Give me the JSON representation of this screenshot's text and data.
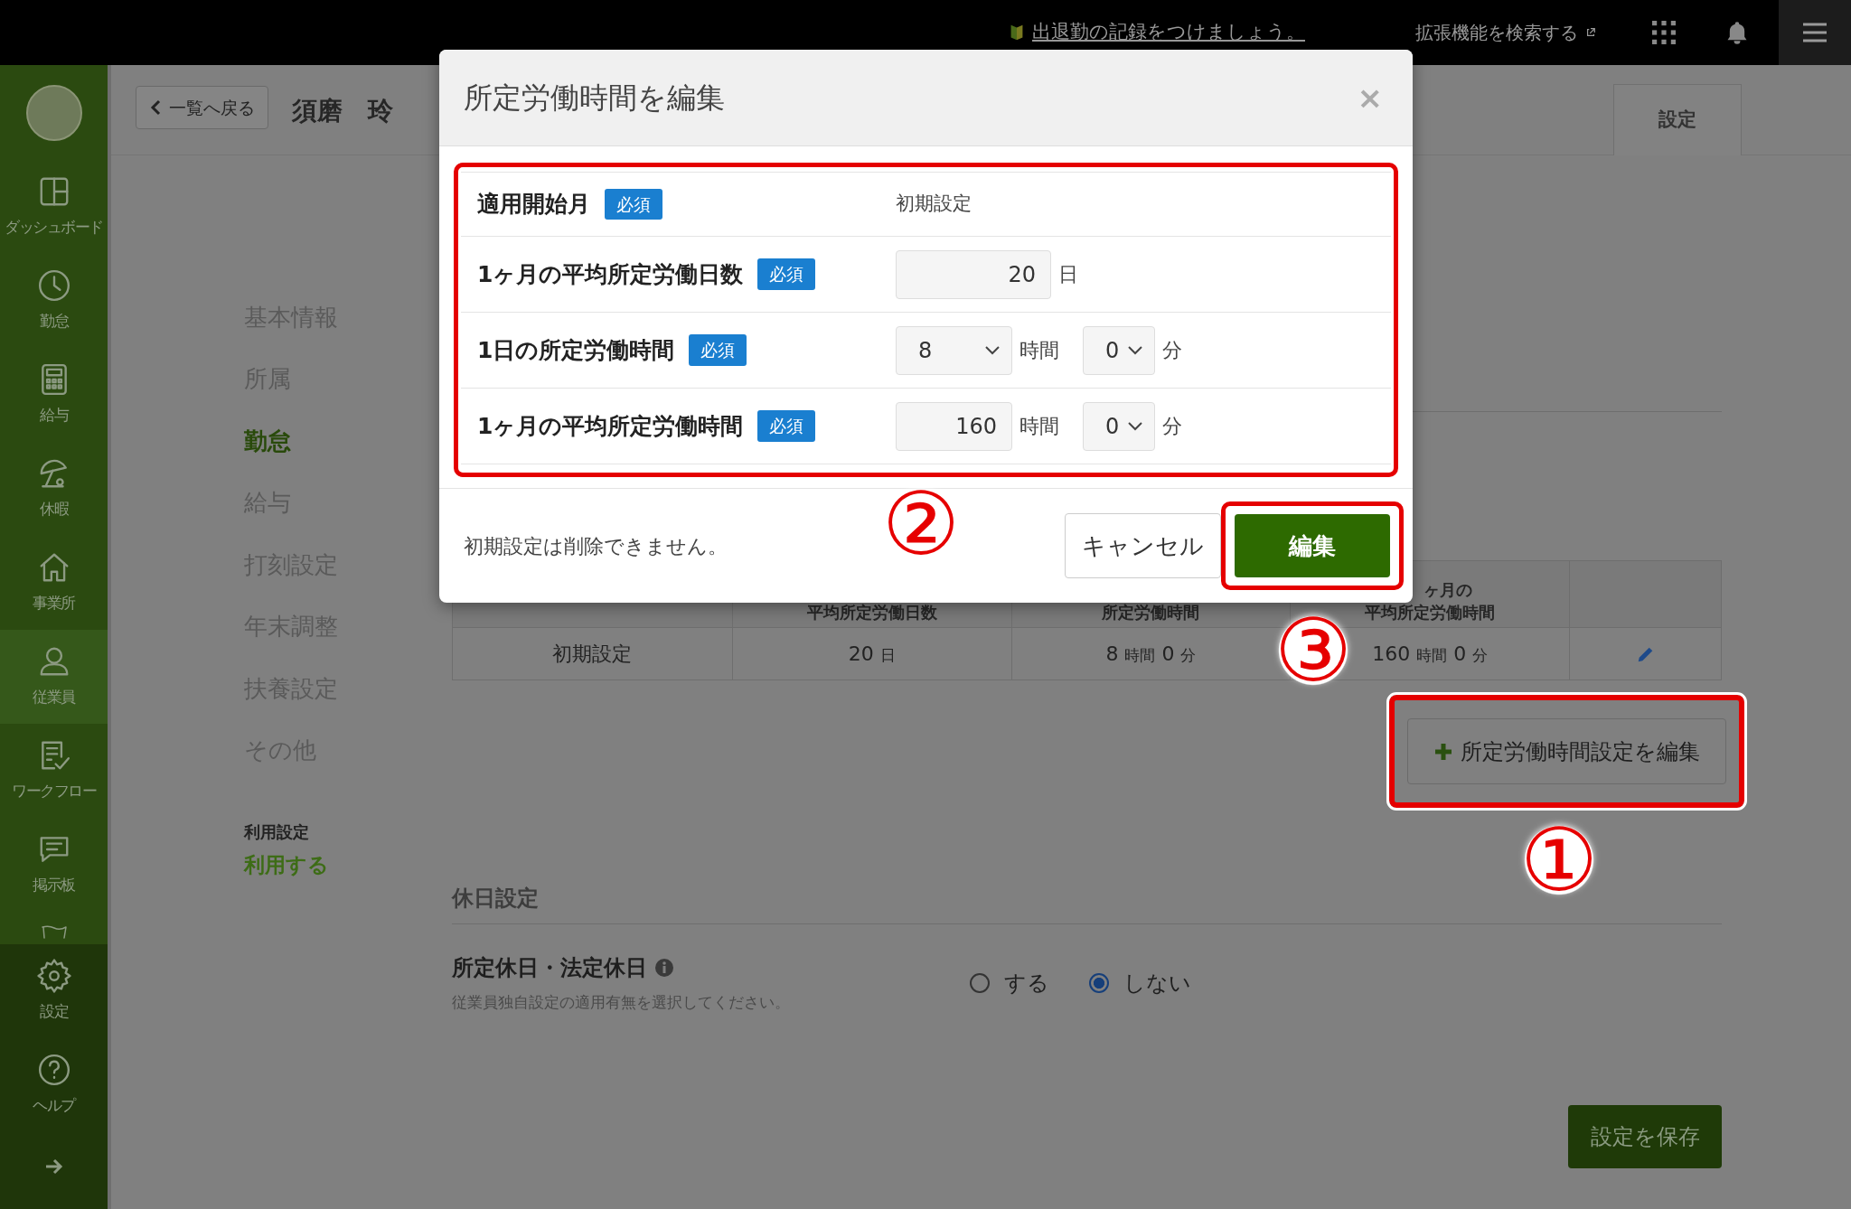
{
  "top_bar": {
    "notice": "出退勤の記録をつけましょう。",
    "extension_link": "拡張機能を検索する"
  },
  "sidebar": {
    "items": [
      {
        "label": "ダッシュボード",
        "selected": false
      },
      {
        "label": "勤怠",
        "selected": false
      },
      {
        "label": "給与",
        "selected": false
      },
      {
        "label": "休暇",
        "selected": false
      },
      {
        "label": "事業所",
        "selected": false
      },
      {
        "label": "従業員",
        "selected": true
      },
      {
        "label": "ワークフロー",
        "selected": false
      },
      {
        "label": "掲示板",
        "selected": false
      }
    ],
    "bottom_items": [
      {
        "label": "設定"
      },
      {
        "label": "ヘルプ"
      }
    ]
  },
  "header": {
    "back_button": "一覧へ戻る",
    "employee_name": "須磨　玲",
    "settings_button": "設定"
  },
  "nav": {
    "items": [
      {
        "label": "基本情報",
        "selected": false
      },
      {
        "label": "所属",
        "selected": false
      },
      {
        "label": "勤怠",
        "selected": true
      },
      {
        "label": "給与",
        "selected": false
      },
      {
        "label": "打刻設定",
        "selected": false
      },
      {
        "label": "年末調整",
        "selected": false
      },
      {
        "label": "扶養設定",
        "selected": false
      },
      {
        "label": "その他",
        "selected": false
      }
    ],
    "usage_label": "利用設定",
    "usage_value": "利用する"
  },
  "table": {
    "columns": [
      {},
      {
        "heading": [
          "平均所定労働日数"
        ]
      },
      {
        "heading": [
          "所定労働時間"
        ]
      },
      {
        "heading": [
          "ヶ月の",
          "平均所定労働時間"
        ]
      },
      {}
    ],
    "rows": [
      {
        "cells": [
          [
            "初期設定"
          ],
          [
            "20",
            "日"
          ],
          [
            "8",
            "時間",
            "0",
            "分"
          ],
          [
            "160",
            "時間",
            "0",
            "分"
          ]
        ]
      }
    ]
  },
  "add_button": "所定労働時間設定を編集",
  "holiday_section": {
    "title": "休日設定",
    "field_label": "所定休日・法定休日",
    "help": "従業員独自設定の適用有無を選択してください。",
    "options": [
      {
        "label": "する",
        "selected": false
      },
      {
        "label": "しない",
        "selected": true
      }
    ]
  },
  "save_button": "設定を保存",
  "modal": {
    "title": "所定労働時間を編集",
    "close": "×",
    "rows": [
      {
        "label": "適用開始月",
        "badge": "必須",
        "controls": [
          {
            "kind": "text",
            "text": "初期設定"
          }
        ]
      },
      {
        "label": "1ヶ月の平均所定労働日数",
        "badge": "必須",
        "controls": [
          {
            "kind": "input",
            "value": "20"
          },
          {
            "kind": "unit",
            "text": "日"
          }
        ]
      },
      {
        "label": "1日の所定労働時間",
        "badge": "必須",
        "controls": [
          {
            "kind": "select",
            "value": "8"
          },
          {
            "kind": "unit",
            "text": "時間"
          },
          {
            "kind": "select",
            "value": "0"
          },
          {
            "kind": "unit",
            "text": "分"
          }
        ]
      },
      {
        "label": "1ヶ月の平均所定労働時間",
        "badge": "必須",
        "controls": [
          {
            "kind": "input",
            "value": "160"
          },
          {
            "kind": "unit",
            "text": "時間"
          },
          {
            "kind": "select",
            "value": "0"
          },
          {
            "kind": "unit",
            "text": "分"
          }
        ]
      }
    ],
    "note": "初期設定は削除できません。",
    "cancel_button": "キャンセル",
    "submit_button": "編集"
  },
  "annotations": [
    {
      "label": "①"
    },
    {
      "label": "②"
    },
    {
      "label": "③"
    }
  ]
}
